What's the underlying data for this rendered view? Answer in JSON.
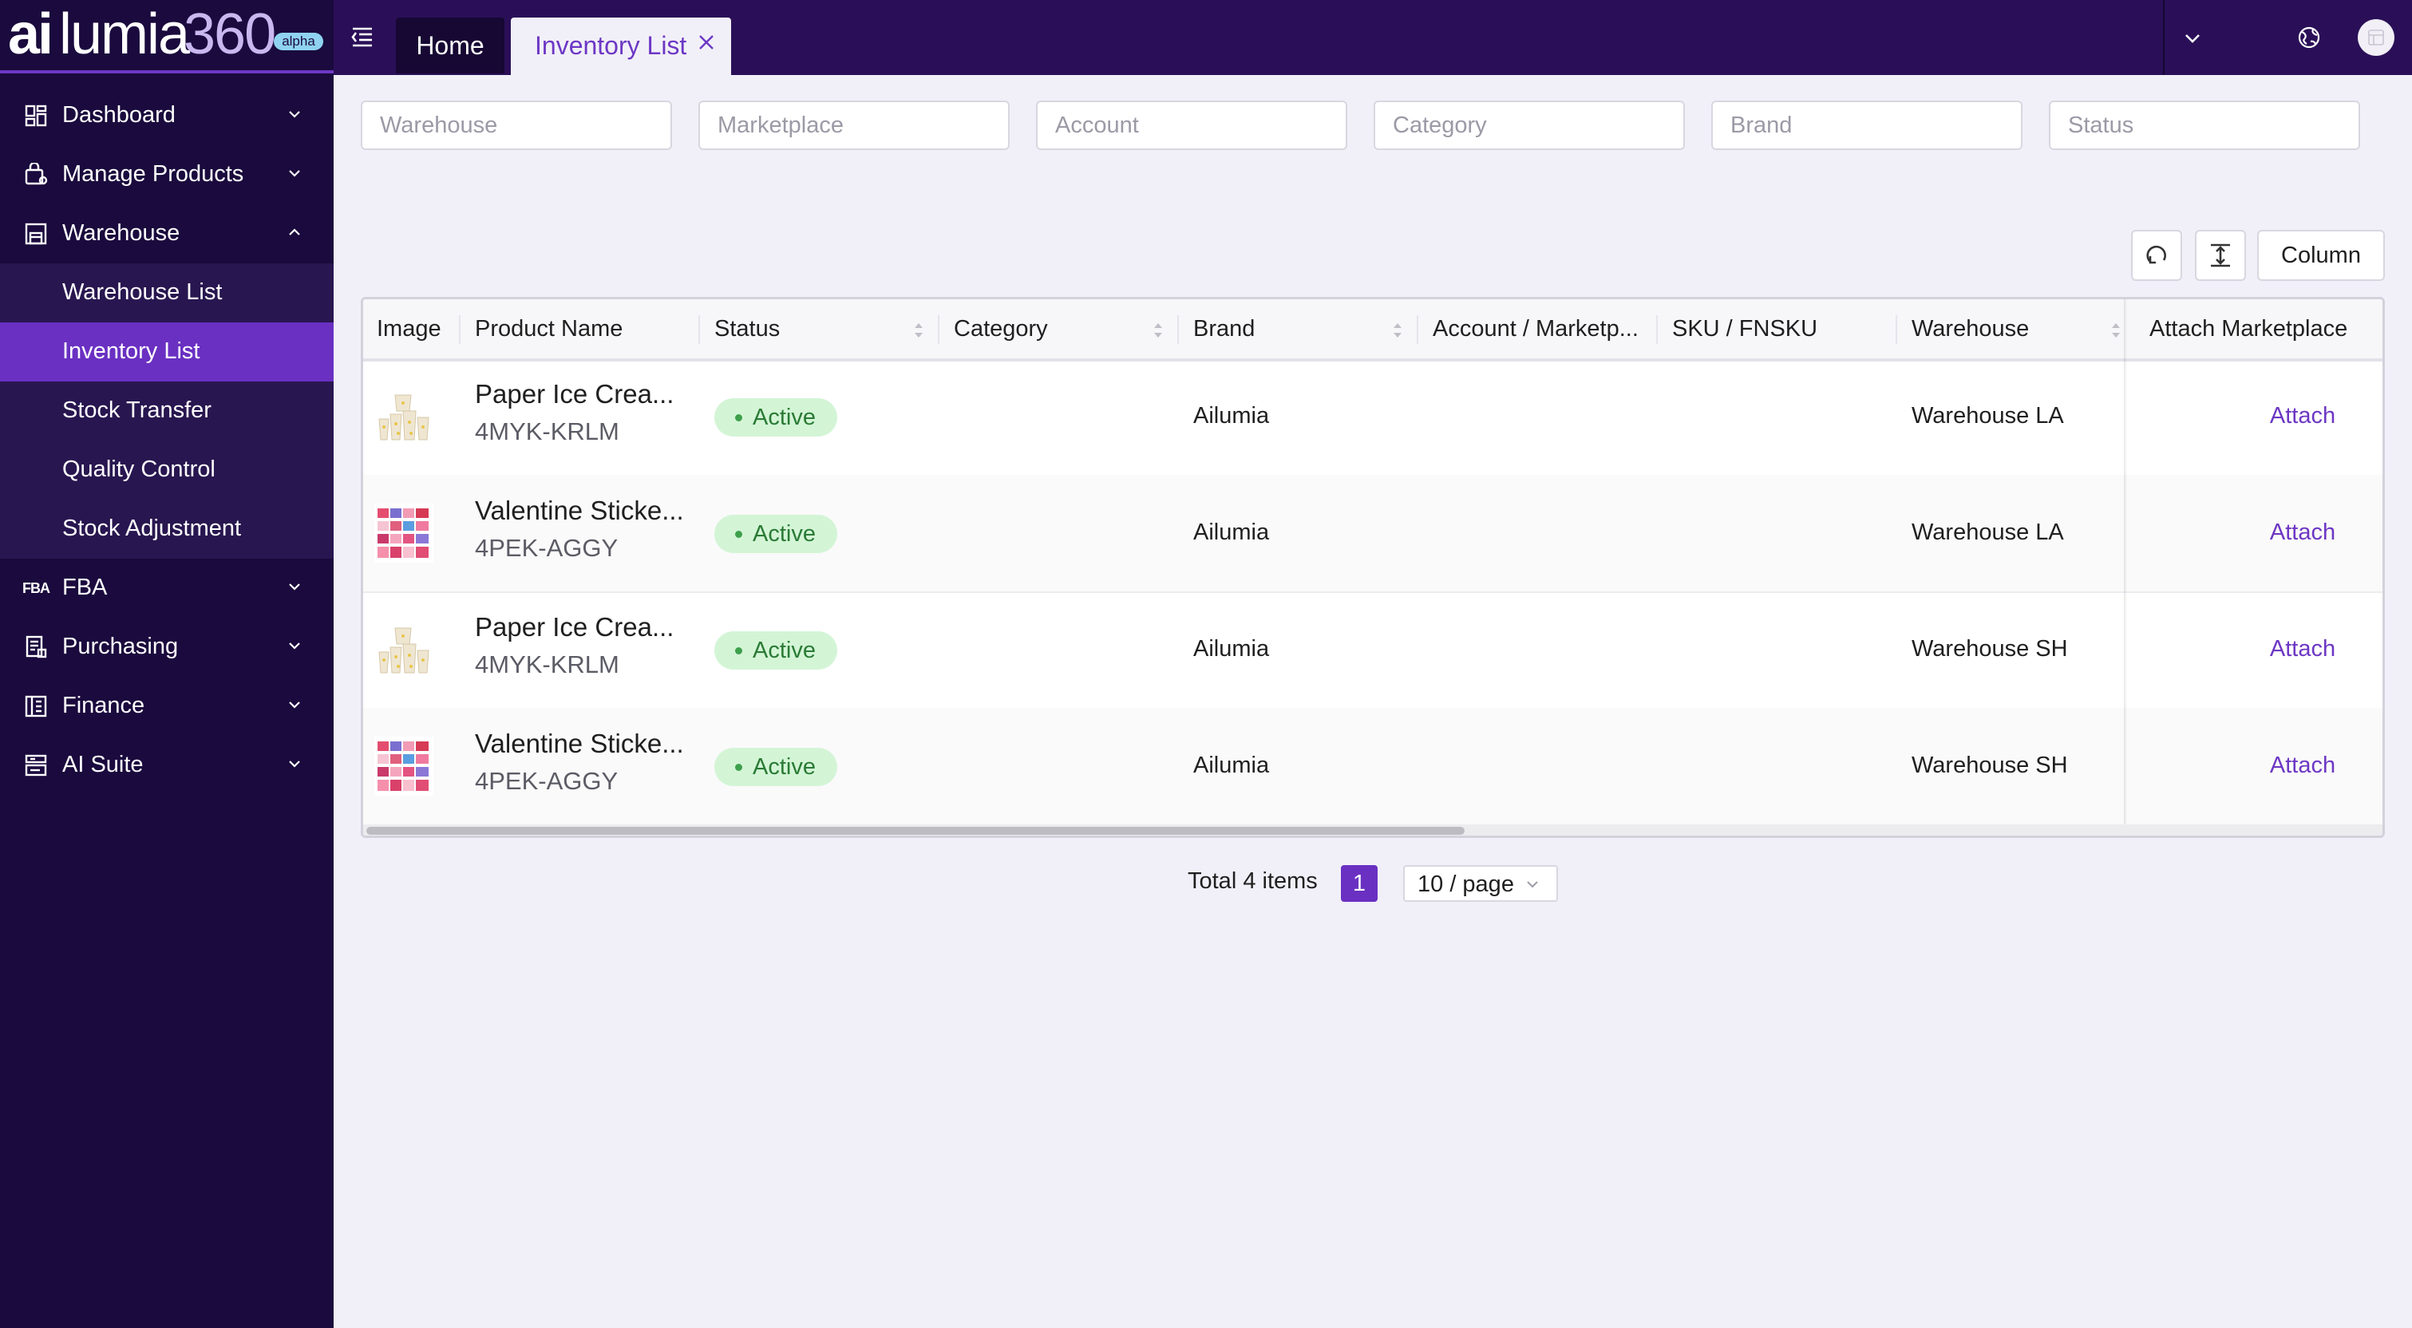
{
  "brand": {
    "name_ai": "ai",
    "name_rest": "lumia",
    "name_num": "360",
    "badge": "alpha"
  },
  "sidebar": {
    "items": [
      {
        "label": "Dashboard",
        "icon": "dashboard-icon"
      },
      {
        "label": "Manage Products",
        "icon": "products-icon"
      },
      {
        "label": "Warehouse",
        "icon": "warehouse-icon"
      },
      {
        "label": "FBA",
        "icon": "fba-icon",
        "icon_text": "FBA"
      },
      {
        "label": "Purchasing",
        "icon": "purchasing-icon"
      },
      {
        "label": "Finance",
        "icon": "finance-icon"
      },
      {
        "label": "AI Suite",
        "icon": "ai-suite-icon"
      }
    ],
    "warehouse_sub": [
      {
        "label": "Warehouse List"
      },
      {
        "label": "Inventory List",
        "active": true
      },
      {
        "label": "Stock Transfer"
      },
      {
        "label": "Quality Control"
      },
      {
        "label": "Stock Adjustment"
      }
    ]
  },
  "tabs": {
    "home": "Home",
    "active": "Inventory List"
  },
  "filters": {
    "warehouse": "Warehouse",
    "marketplace": "Marketplace",
    "account": "Account",
    "category": "Category",
    "brand": "Brand",
    "status": "Status"
  },
  "toolbar": {
    "column_label": "Column"
  },
  "table": {
    "headers": {
      "image": "Image",
      "product_name": "Product Name",
      "status": "Status",
      "category": "Category",
      "brand": "Brand",
      "account": "Account / Marketp...",
      "sku": "SKU / FNSKU",
      "warehouse": "Warehouse",
      "attach": "Attach Marketplace"
    },
    "rows": [
      {
        "name": "Paper Ice Crea...",
        "sku": "4MYK-KRLM",
        "status": "Active",
        "category": "",
        "brand": "Ailumia",
        "account": "",
        "fnsku": "",
        "warehouse": "Warehouse LA",
        "action": "Attach"
      },
      {
        "name": "Valentine Sticke...",
        "sku": "4PEK-AGGY",
        "status": "Active",
        "category": "",
        "brand": "Ailumia",
        "account": "",
        "fnsku": "",
        "warehouse": "Warehouse LA",
        "action": "Attach"
      },
      {
        "name": "Paper Ice Crea...",
        "sku": "4MYK-KRLM",
        "status": "Active",
        "category": "",
        "brand": "Ailumia",
        "account": "",
        "fnsku": "",
        "warehouse": "Warehouse SH",
        "action": "Attach"
      },
      {
        "name": "Valentine Sticke...",
        "sku": "4PEK-AGGY",
        "status": "Active",
        "category": "",
        "brand": "Ailumia",
        "account": "",
        "fnsku": "",
        "warehouse": "Warehouse SH",
        "action": "Attach"
      }
    ]
  },
  "pagination": {
    "total": "Total 4 items",
    "current_page": "1",
    "page_size": "10 / page"
  },
  "colors": {
    "sidebar_bg": "#1a0a3d",
    "accent": "#6a30c2",
    "header_bg": "#2a0f58",
    "active_badge_bg": "#d3f5d6",
    "active_badge_text": "#2a7a35",
    "link": "#6d37c4"
  }
}
